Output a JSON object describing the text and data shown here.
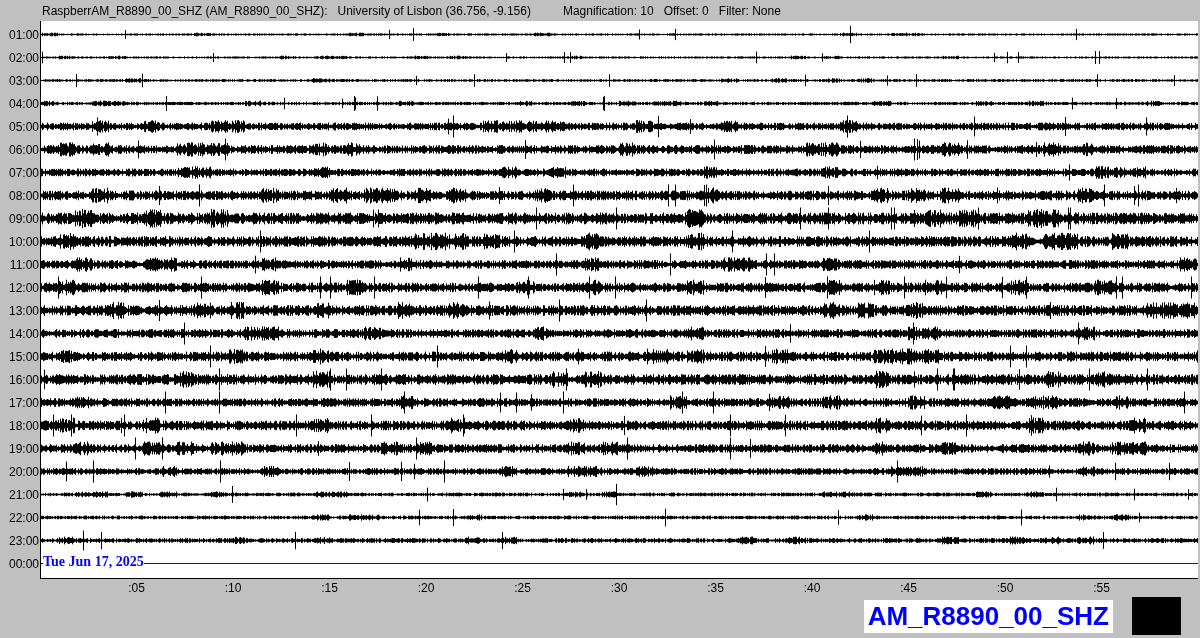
{
  "header": {
    "station": "RaspberrAM_R8890_00_SHZ (AM_R8890_00_SHZ):",
    "location": "University of Lisbon (36.756, -9.156)",
    "magnification": "Magnification: 10",
    "offset": "Offset: 0",
    "filter": "Filter: None"
  },
  "rows": [
    {
      "label": "01:00"
    },
    {
      "label": "02:00"
    },
    {
      "label": "03:00"
    },
    {
      "label": "04:00"
    },
    {
      "label": "05:00"
    },
    {
      "label": "06:00"
    },
    {
      "label": "07:00"
    },
    {
      "label": "08:00"
    },
    {
      "label": "09:00"
    },
    {
      "label": "10:00"
    },
    {
      "label": "11:00"
    },
    {
      "label": "12:00"
    },
    {
      "label": "13:00"
    },
    {
      "label": "14:00"
    },
    {
      "label": "15:00"
    },
    {
      "label": "16:00"
    },
    {
      "label": "17:00"
    },
    {
      "label": "18:00"
    },
    {
      "label": "19:00"
    },
    {
      "label": "20:00"
    },
    {
      "label": "21:00"
    },
    {
      "label": "22:00"
    },
    {
      "label": "23:00"
    }
  ],
  "current_row": {
    "label": "00:00",
    "date": "Tue Jun 17, 2025"
  },
  "x_ticks": [
    ":05",
    ":10",
    ":15",
    ":20",
    ":25",
    ":30",
    ":35",
    ":40",
    ":45",
    ":50",
    ":55"
  ],
  "station_label": "AM_R8890_00_SHZ"
}
